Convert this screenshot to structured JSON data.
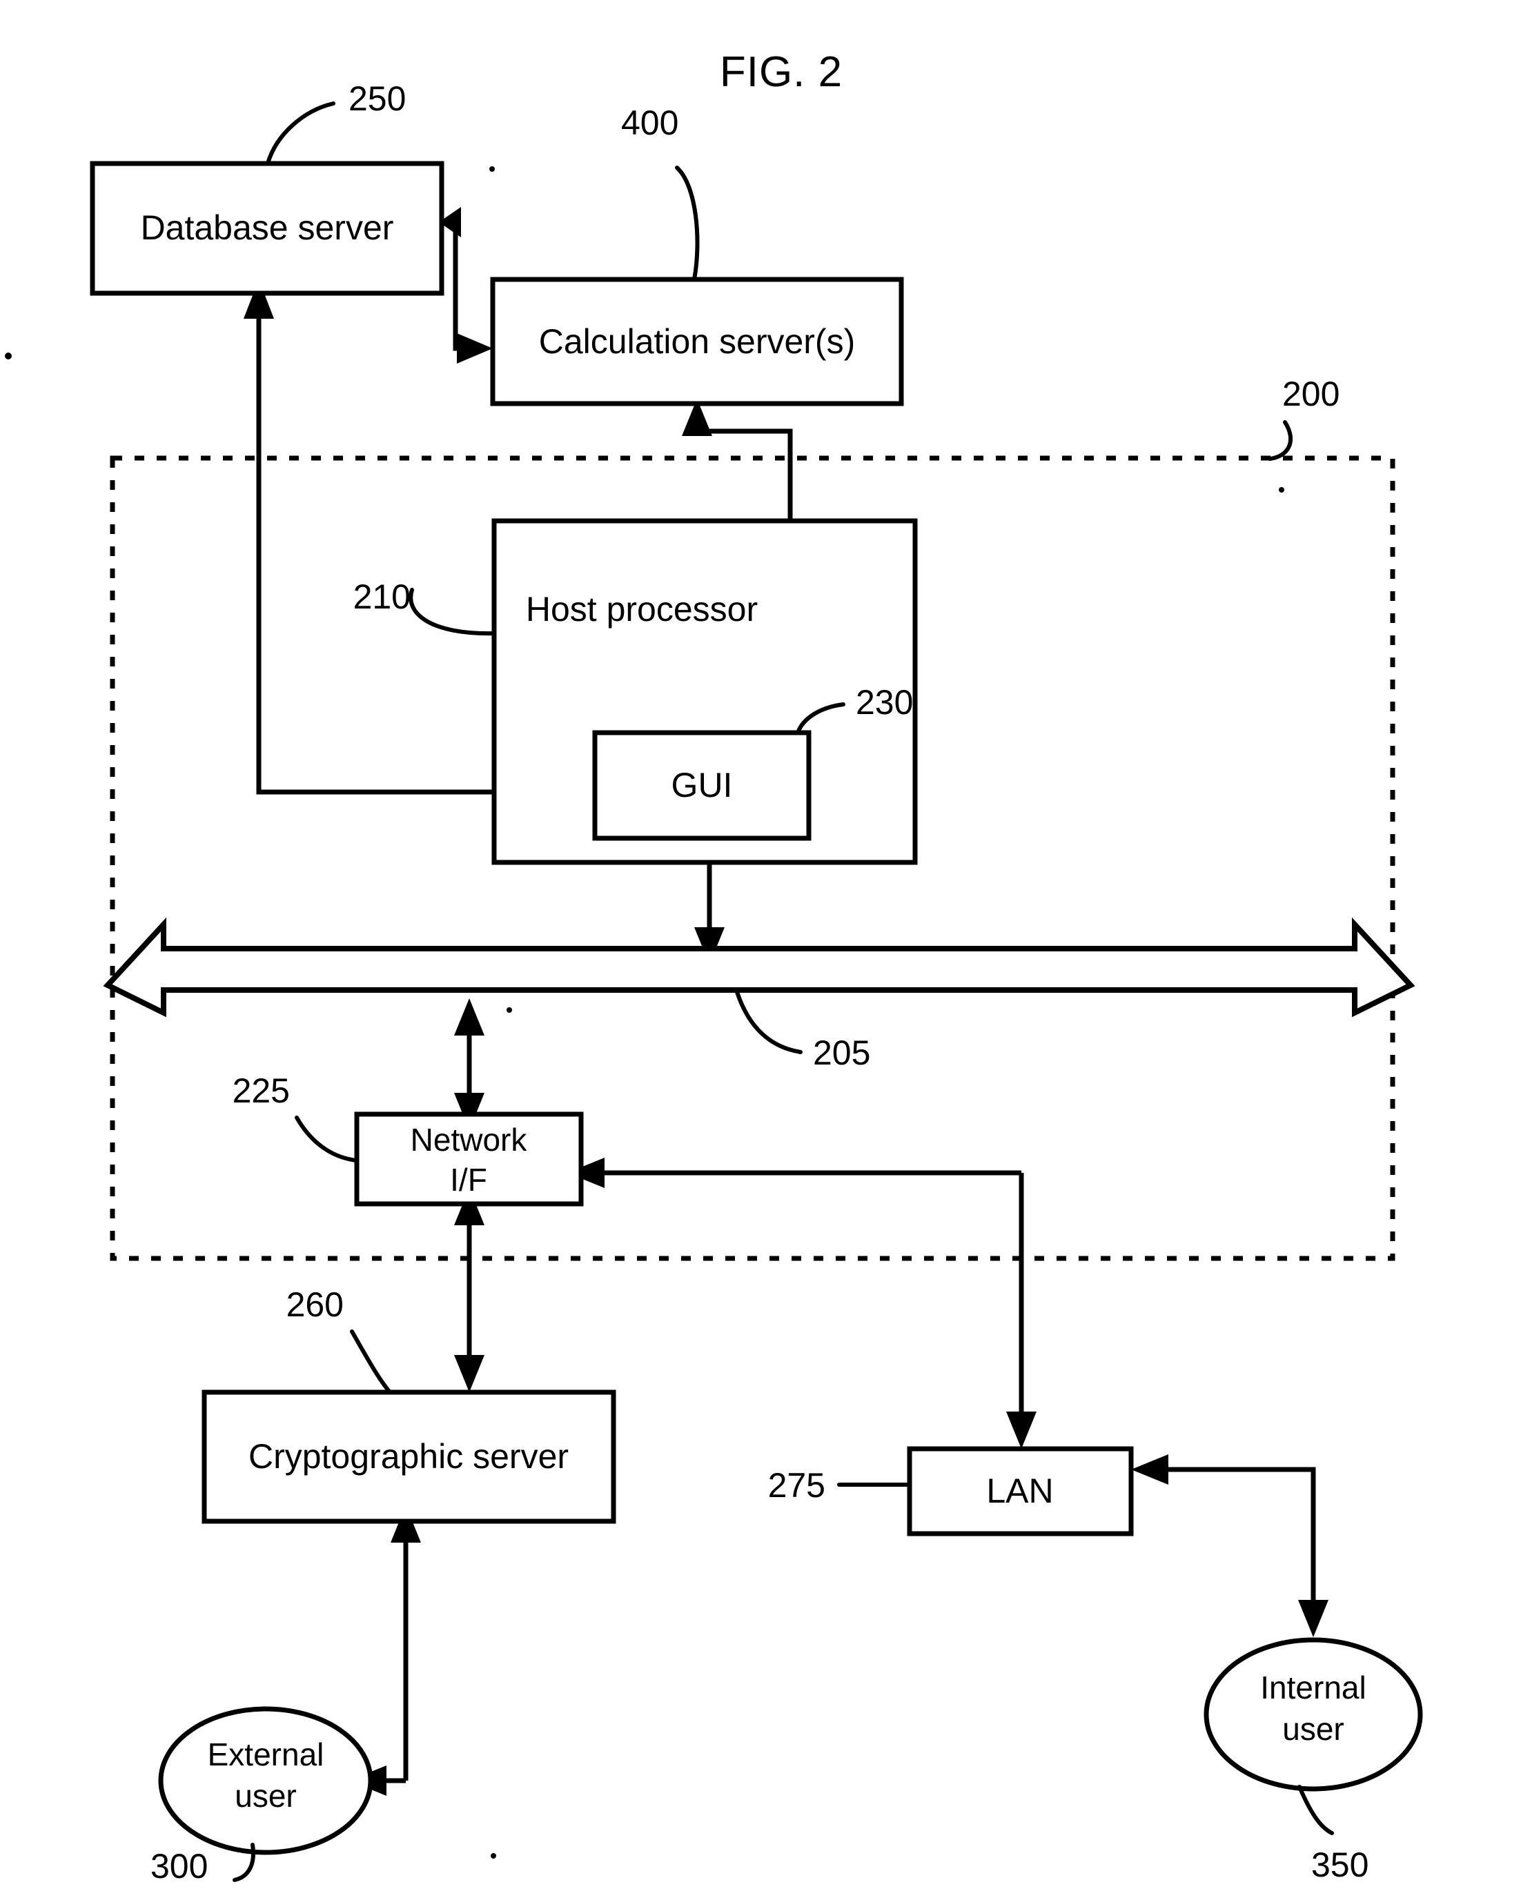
{
  "figure": {
    "title": "FIG. 2"
  },
  "nodes": {
    "database_server": {
      "label": "Database server",
      "ref": "250"
    },
    "calculation_server": {
      "label": "Calculation server(s)",
      "ref": "400"
    },
    "host_processor": {
      "label": "Host processor",
      "ref": "210"
    },
    "gui": {
      "label": "GUI",
      "ref": "230"
    },
    "network_if": {
      "label_line1": "Network",
      "label_line2": "I/F",
      "ref": "225"
    },
    "cryptographic_server": {
      "label": "Cryptographic server",
      "ref": "260"
    },
    "lan": {
      "label": "LAN",
      "ref": "275"
    },
    "internal_user": {
      "label_line1": "Internal",
      "label_line2": "user",
      "ref": "350"
    },
    "external_user": {
      "label_line1": "External",
      "label_line2": "user",
      "ref": "300"
    },
    "bus": {
      "ref": "205"
    },
    "system_boundary": {
      "ref": "200"
    }
  },
  "colors": {
    "stroke": "#000000",
    "fill": "#ffffff"
  }
}
